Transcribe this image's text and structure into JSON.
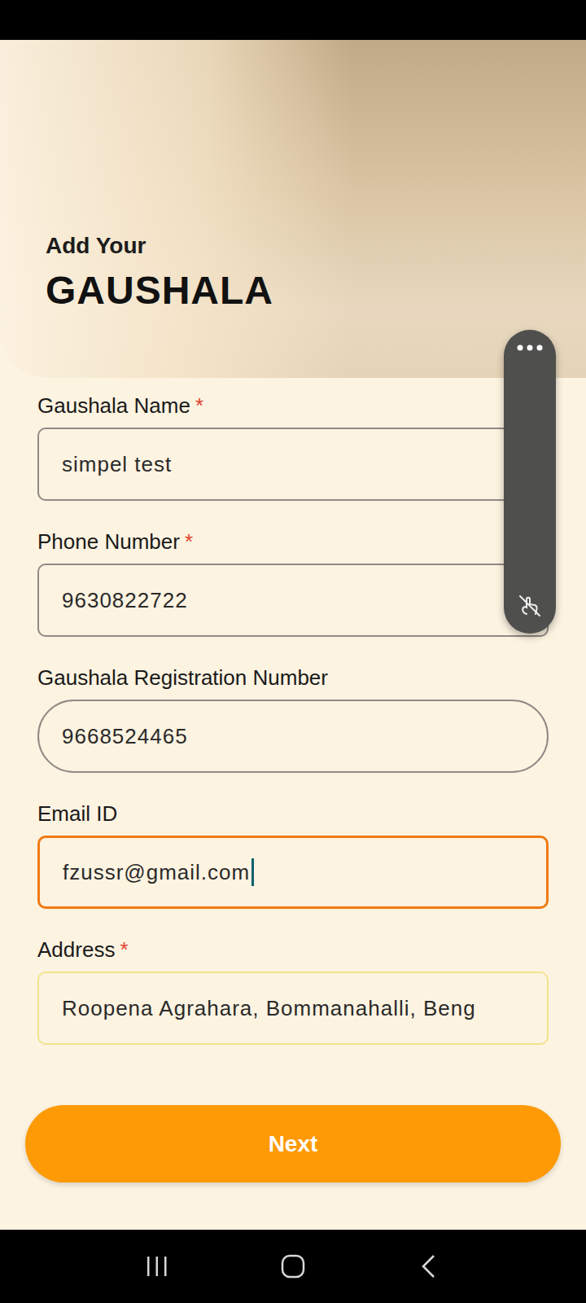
{
  "header": {
    "subtitle": "Add Your",
    "title": "GAUSHALA"
  },
  "required_mark": "*",
  "fields": [
    {
      "label": "Gaushala Name",
      "value": "simpel test",
      "required": true,
      "kind": "box",
      "focused": false,
      "autofilled": false
    },
    {
      "label": "Phone Number",
      "value": "9630822722",
      "required": true,
      "kind": "box",
      "focused": false,
      "autofilled": false
    },
    {
      "label": "Gaushala Registration Number",
      "value": "9668524465",
      "required": false,
      "kind": "pill",
      "focused": false,
      "autofilled": false
    },
    {
      "label": "Email ID",
      "value": "fzussr@gmail.com",
      "required": false,
      "kind": "box",
      "focused": true,
      "autofilled": false
    },
    {
      "label": "Address",
      "value": "Roopena Agrahara, Bommanahalli, Beng",
      "required": true,
      "kind": "box",
      "focused": false,
      "autofilled": true
    }
  ],
  "button": "Next"
}
